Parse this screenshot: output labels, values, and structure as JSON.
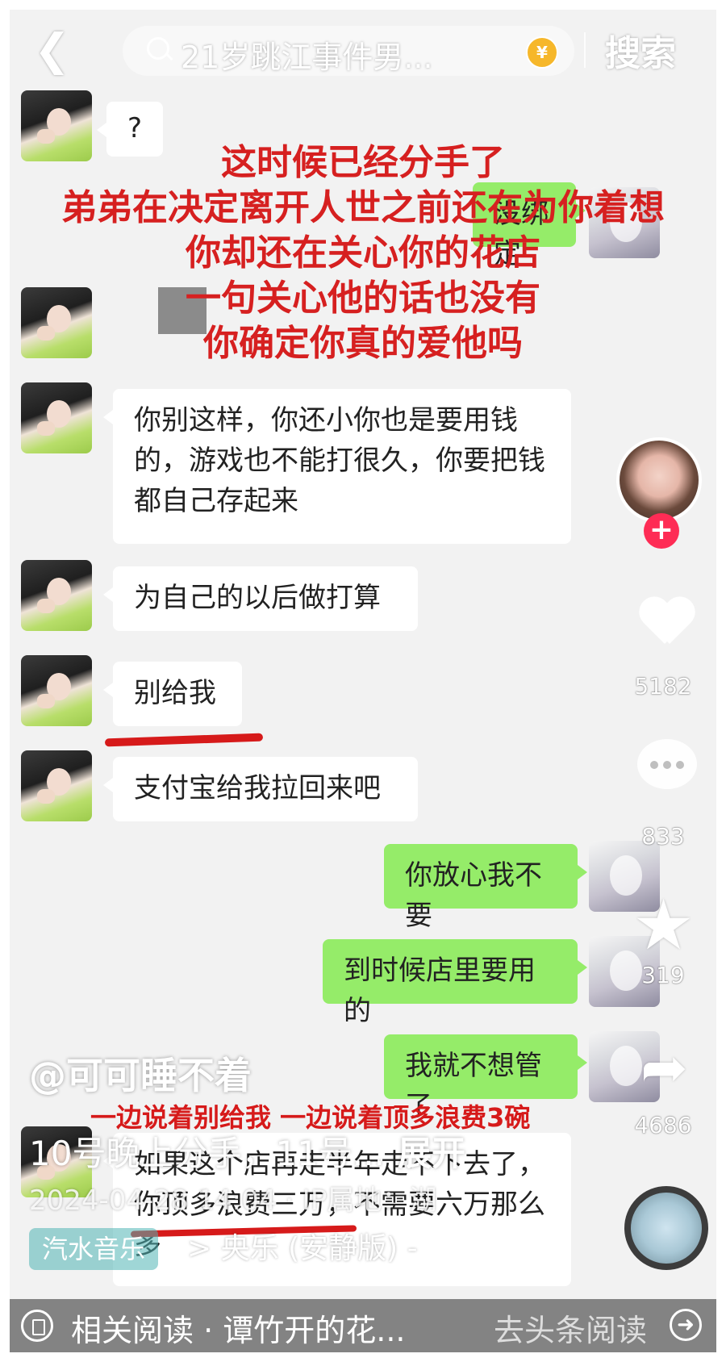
{
  "search": {
    "back_icon": "chevron-left-icon",
    "query": "21岁跳江事件男...",
    "coin_icon": "¥",
    "button": "搜索"
  },
  "messages": [
    {
      "side": "left",
      "text": "?"
    },
    {
      "side": "right",
      "text": "没绑定"
    },
    {
      "side": "left",
      "text": "你别这样，你还小你也是要用钱的，游戏也不能打很久，你要把钱都自己存起来"
    },
    {
      "side": "left",
      "text": "为自己的以后做打算"
    },
    {
      "side": "left",
      "text": "别给我"
    },
    {
      "side": "left",
      "text": "支付宝给我拉回来吧"
    },
    {
      "side": "right",
      "text": "你放心我不要"
    },
    {
      "side": "right",
      "text": "到时候店里要用的"
    },
    {
      "side": "right",
      "text": "我就不想管了"
    },
    {
      "side": "left",
      "text": "如果这个店再走半年走不下去了，你顶多浪费三万，不需要六万那么多"
    }
  ],
  "annotation": {
    "lines": [
      "这时候已经分手了",
      "弟弟在决定离开人世之前还在为你着想",
      "你却还在关心你的花店",
      "一句关心他的话也没有",
      "你确定你真的爱他吗"
    ],
    "bottom_line": "一边说着别给我 一边说着顶多浪费3碗"
  },
  "side": {
    "follow": "+",
    "likes": "5182",
    "comments": "833",
    "favorites": "319",
    "shares": "4686"
  },
  "video": {
    "author": "@可可睡不着",
    "description": "10号晚上分手，11号...",
    "expand": "展开",
    "date": "2024-04-28 14:04 · IP属地：湖",
    "music_tag": "汽水音乐",
    "song": "> 央乐 (安静版) -"
  },
  "bottom": {
    "related": "相关阅读 · 谭竹开的花...",
    "go": "去头条阅读"
  },
  "colors": {
    "bubble_green": "#95ec69",
    "annotation_red": "#d62020",
    "follow_red": "#fe2c55"
  }
}
